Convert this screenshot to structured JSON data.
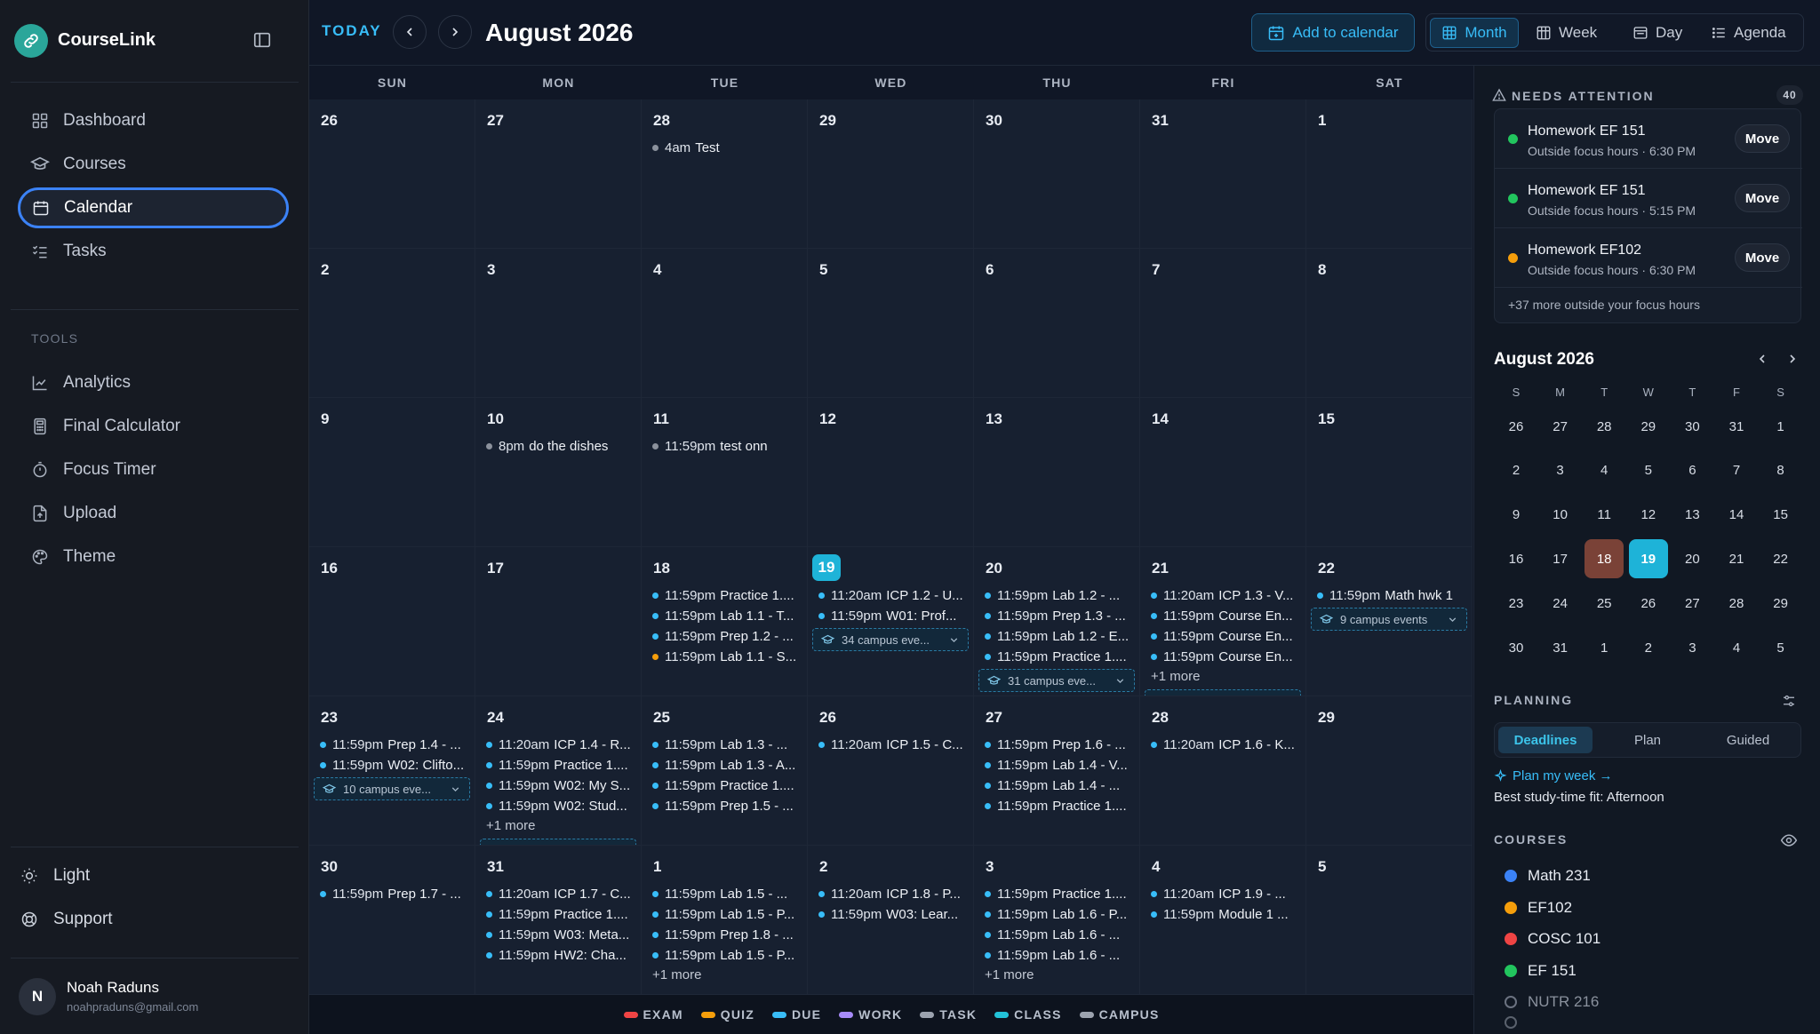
{
  "app": {
    "name": "CourseLink"
  },
  "nav": {
    "items": [
      {
        "label": "Dashboard",
        "icon": "dashboard-icon"
      },
      {
        "label": "Courses",
        "icon": "graduation-cap-icon"
      },
      {
        "label": "Calendar",
        "icon": "calendar-icon",
        "active": true
      },
      {
        "label": "Tasks",
        "icon": "checklist-icon"
      }
    ],
    "tools_heading": "TOOLS",
    "tools": [
      {
        "label": "Analytics",
        "icon": "line-chart-icon"
      },
      {
        "label": "Final Calculator",
        "icon": "calculator-icon"
      },
      {
        "label": "Focus Timer",
        "icon": "timer-icon"
      },
      {
        "label": "Upload",
        "icon": "upload-icon"
      },
      {
        "label": "Theme",
        "icon": "palette-icon"
      }
    ],
    "theme_toggle": "Light",
    "support": "Support"
  },
  "user": {
    "initial": "N",
    "name": "Noah Raduns",
    "email": "noahpraduns@gmail.com"
  },
  "toolbar": {
    "today": "TODAY",
    "title": "August 2026",
    "add_to_calendar": "Add to calendar",
    "views": {
      "month": "Month",
      "week": "Week",
      "day": "Day",
      "agenda": "Agenda"
    },
    "active_view": "Month"
  },
  "calendar": {
    "weekdays": [
      "SUN",
      "MON",
      "TUE",
      "WED",
      "THU",
      "FRI",
      "SAT"
    ],
    "weeks": [
      [
        {
          "day": "26",
          "events": []
        },
        {
          "day": "27",
          "events": []
        },
        {
          "day": "28",
          "events": [
            {
              "time": "4am",
              "title": "Test",
              "color": "#8b919c"
            }
          ]
        },
        {
          "day": "29",
          "events": []
        },
        {
          "day": "30",
          "events": []
        },
        {
          "day": "31",
          "events": []
        },
        {
          "day": "1",
          "events": []
        }
      ],
      [
        {
          "day": "2",
          "events": []
        },
        {
          "day": "3",
          "events": []
        },
        {
          "day": "4",
          "events": []
        },
        {
          "day": "5",
          "events": []
        },
        {
          "day": "6",
          "events": []
        },
        {
          "day": "7",
          "events": []
        },
        {
          "day": "8",
          "events": []
        }
      ],
      [
        {
          "day": "9",
          "events": []
        },
        {
          "day": "10",
          "events": [
            {
              "time": "8pm",
              "title": "do the dishes",
              "color": "#8b919c"
            }
          ]
        },
        {
          "day": "11",
          "events": [
            {
              "time": "11:59pm",
              "title": "test onn",
              "color": "#8b919c"
            }
          ]
        },
        {
          "day": "12",
          "events": []
        },
        {
          "day": "13",
          "events": []
        },
        {
          "day": "14",
          "events": []
        },
        {
          "day": "15",
          "events": []
        }
      ],
      [
        {
          "day": "16",
          "events": []
        },
        {
          "day": "17",
          "events": []
        },
        {
          "day": "18",
          "events": [
            {
              "time": "11:59pm",
              "title": "Practice 1....",
              "color": "#38bdf8"
            },
            {
              "time": "11:59pm",
              "title": "Lab 1.1 - T...",
              "color": "#38bdf8"
            },
            {
              "time": "11:59pm",
              "title": "Prep 1.2 - ...",
              "color": "#38bdf8"
            },
            {
              "time": "11:59pm",
              "title": "Lab 1.1 - S...",
              "color": "#f59e0b"
            }
          ]
        },
        {
          "day": "19",
          "today": true,
          "events": [
            {
              "time": "11:20am",
              "title": "ICP 1.2 - U...",
              "color": "#38bdf8"
            },
            {
              "time": "11:59pm",
              "title": "W01: Prof...",
              "color": "#38bdf8"
            }
          ],
          "campus": "34 campus eve..."
        },
        {
          "day": "20",
          "events": [
            {
              "time": "11:59pm",
              "title": "Lab 1.2 - ...",
              "color": "#38bdf8"
            },
            {
              "time": "11:59pm",
              "title": "Prep 1.3 - ...",
              "color": "#38bdf8"
            },
            {
              "time": "11:59pm",
              "title": "Lab 1.2 - E...",
              "color": "#38bdf8"
            },
            {
              "time": "11:59pm",
              "title": "Practice 1....",
              "color": "#38bdf8"
            }
          ],
          "campus": "31 campus eve..."
        },
        {
          "day": "21",
          "events": [
            {
              "time": "11:20am",
              "title": "ICP 1.3 - V...",
              "color": "#38bdf8"
            },
            {
              "time": "11:59pm",
              "title": "Course En...",
              "color": "#38bdf8"
            },
            {
              "time": "11:59pm",
              "title": "Course En...",
              "color": "#38bdf8"
            },
            {
              "time": "11:59pm",
              "title": "Course En...",
              "color": "#38bdf8"
            }
          ],
          "more": "+1 more",
          "campus_clipped": true
        },
        {
          "day": "22",
          "events": [
            {
              "time": "11:59pm",
              "title": "Math hwk 1",
              "color": "#38bdf8"
            }
          ],
          "campus": "9 campus events"
        }
      ],
      [
        {
          "day": "23",
          "events": [
            {
              "time": "11:59pm",
              "title": "Prep 1.4 - ...",
              "color": "#38bdf8"
            },
            {
              "time": "11:59pm",
              "title": "W02: Clifto...",
              "color": "#38bdf8"
            }
          ],
          "campus": "10 campus eve..."
        },
        {
          "day": "24",
          "events": [
            {
              "time": "11:20am",
              "title": "ICP 1.4 - R...",
              "color": "#38bdf8"
            },
            {
              "time": "11:59pm",
              "title": "Practice 1....",
              "color": "#38bdf8"
            },
            {
              "time": "11:59pm",
              "title": "W02: My S...",
              "color": "#38bdf8"
            },
            {
              "time": "11:59pm",
              "title": "W02: Stud...",
              "color": "#38bdf8"
            }
          ],
          "more": "+1 more",
          "campus_clipped": true
        },
        {
          "day": "25",
          "events": [
            {
              "time": "11:59pm",
              "title": "Lab 1.3 - ...",
              "color": "#38bdf8"
            },
            {
              "time": "11:59pm",
              "title": "Lab 1.3 - A...",
              "color": "#38bdf8"
            },
            {
              "time": "11:59pm",
              "title": "Practice 1....",
              "color": "#38bdf8"
            },
            {
              "time": "11:59pm",
              "title": "Prep 1.5 - ...",
              "color": "#38bdf8"
            }
          ]
        },
        {
          "day": "26",
          "events": [
            {
              "time": "11:20am",
              "title": "ICP 1.5 - C...",
              "color": "#38bdf8"
            }
          ]
        },
        {
          "day": "27",
          "events": [
            {
              "time": "11:59pm",
              "title": "Prep 1.6 - ...",
              "color": "#38bdf8"
            },
            {
              "time": "11:59pm",
              "title": "Lab 1.4 - V...",
              "color": "#38bdf8"
            },
            {
              "time": "11:59pm",
              "title": "Lab 1.4 - ...",
              "color": "#38bdf8"
            },
            {
              "time": "11:59pm",
              "title": "Practice 1....",
              "color": "#38bdf8"
            }
          ]
        },
        {
          "day": "28",
          "events": [
            {
              "time": "11:20am",
              "title": "ICP 1.6 - K...",
              "color": "#38bdf8"
            }
          ]
        },
        {
          "day": "29",
          "events": []
        }
      ],
      [
        {
          "day": "30",
          "events": [
            {
              "time": "11:59pm",
              "title": "Prep 1.7 - ...",
              "color": "#38bdf8"
            }
          ]
        },
        {
          "day": "31",
          "events": [
            {
              "time": "11:20am",
              "title": "ICP 1.7 - C...",
              "color": "#38bdf8"
            },
            {
              "time": "11:59pm",
              "title": "Practice 1....",
              "color": "#38bdf8"
            },
            {
              "time": "11:59pm",
              "title": "W03: Meta...",
              "color": "#38bdf8"
            },
            {
              "time": "11:59pm",
              "title": "HW2: Cha...",
              "color": "#38bdf8"
            }
          ]
        },
        {
          "day": "1",
          "events": [
            {
              "time": "11:59pm",
              "title": "Lab 1.5 - ...",
              "color": "#38bdf8"
            },
            {
              "time": "11:59pm",
              "title": "Lab 1.5 - P...",
              "color": "#38bdf8"
            },
            {
              "time": "11:59pm",
              "title": "Prep 1.8 - ...",
              "color": "#38bdf8"
            },
            {
              "time": "11:59pm",
              "title": "Lab 1.5 - P...",
              "color": "#38bdf8"
            }
          ],
          "more": "+1 more"
        },
        {
          "day": "2",
          "events": [
            {
              "time": "11:20am",
              "title": "ICP 1.8 - P...",
              "color": "#38bdf8"
            },
            {
              "time": "11:59pm",
              "title": "W03: Lear...",
              "color": "#38bdf8"
            }
          ]
        },
        {
          "day": "3",
          "events": [
            {
              "time": "11:59pm",
              "title": "Practice 1....",
              "color": "#38bdf8"
            },
            {
              "time": "11:59pm",
              "title": "Lab 1.6 - P...",
              "color": "#38bdf8"
            },
            {
              "time": "11:59pm",
              "title": "Lab 1.6 - ...",
              "color": "#38bdf8"
            },
            {
              "time": "11:59pm",
              "title": "Lab 1.6 - ...",
              "color": "#38bdf8"
            }
          ],
          "more": "+1 more"
        },
        {
          "day": "4",
          "events": [
            {
              "time": "11:20am",
              "title": "ICP 1.9 - ...",
              "color": "#38bdf8"
            },
            {
              "time": "11:59pm",
              "title": "Module 1 ...",
              "color": "#38bdf8"
            }
          ]
        },
        {
          "day": "5",
          "events": []
        }
      ]
    ]
  },
  "legend": [
    {
      "label": "EXAM",
      "color": "#ef4444"
    },
    {
      "label": "QUIZ",
      "color": "#f59e0b"
    },
    {
      "label": "DUE",
      "color": "#38bdf8"
    },
    {
      "label": "WORK",
      "color": "#a78bfa"
    },
    {
      "label": "TASK",
      "color": "#9ca3af"
    },
    {
      "label": "CLASS",
      "color": "#22c2d8"
    },
    {
      "label": "CAMPUS",
      "color": "#9ca3af"
    }
  ],
  "attention": {
    "heading": "NEEDS ATTENTION",
    "count": "40",
    "items": [
      {
        "title": "Homework EF 151",
        "sub": "Outside focus hours · 6:30 PM",
        "color": "#22c55e",
        "action": "Move"
      },
      {
        "title": "Homework EF 151",
        "sub": "Outside focus hours · 5:15 PM",
        "color": "#22c55e",
        "action": "Move"
      },
      {
        "title": "Homework EF102",
        "sub": "Outside focus hours · 6:30 PM",
        "color": "#f59e0b",
        "action": "Move"
      }
    ],
    "more": "+37 more outside your focus hours"
  },
  "mini_calendar": {
    "title": "August 2026",
    "weekdays": [
      "S",
      "M",
      "T",
      "W",
      "T",
      "F",
      "S"
    ],
    "days": [
      [
        "26",
        "27",
        "28",
        "29",
        "30",
        "31",
        "1"
      ],
      [
        "2",
        "3",
        "4",
        "5",
        "6",
        "7",
        "8"
      ],
      [
        "9",
        "10",
        "11",
        "12",
        "13",
        "14",
        "15"
      ],
      [
        "16",
        "17",
        "18",
        "19",
        "20",
        "21",
        "22"
      ],
      [
        "23",
        "24",
        "25",
        "26",
        "27",
        "28",
        "29"
      ],
      [
        "30",
        "31",
        "1",
        "2",
        "3",
        "4",
        "5"
      ]
    ],
    "selected": "18",
    "today": "19"
  },
  "planning": {
    "heading": "PLANNING",
    "tabs": [
      "Deadlines",
      "Plan",
      "Guided"
    ],
    "active_tab": "Deadlines",
    "plan_link": "Plan my week →",
    "fit_label": "Best study-time fit:",
    "fit_value": "Afternoon"
  },
  "courses": {
    "heading": "COURSES",
    "items": [
      {
        "name": "Math 231",
        "color": "#3b82f6",
        "enabled": true
      },
      {
        "name": "EF102",
        "color": "#f59e0b",
        "enabled": true
      },
      {
        "name": "COSC 101",
        "color": "#ef4444",
        "enabled": true
      },
      {
        "name": "EF 151",
        "color": "#22c55e",
        "enabled": true
      },
      {
        "name": "NUTR 216",
        "color": "#6b7280",
        "enabled": false
      }
    ]
  }
}
